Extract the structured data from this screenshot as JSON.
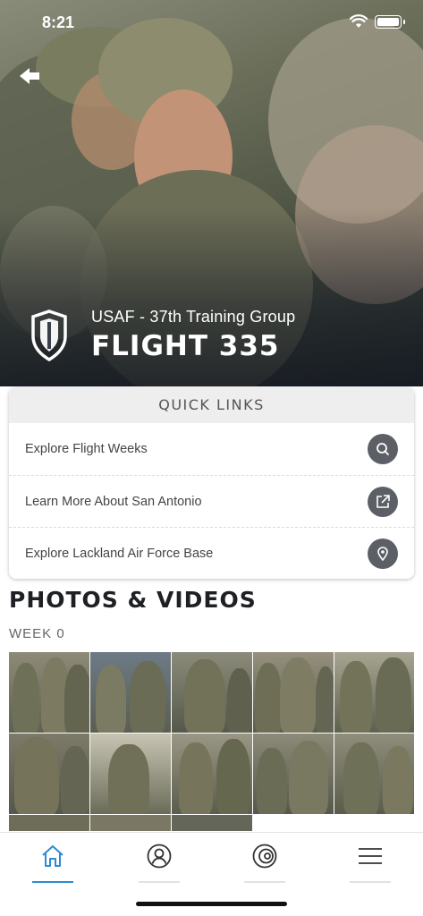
{
  "status_bar": {
    "time": "8:21"
  },
  "hero": {
    "subtitle": "USAF - 37th Training Group",
    "title": "FLIGHT 335"
  },
  "quick_links": {
    "header": "QUICK LINKS",
    "items": [
      {
        "label": "Explore Flight Weeks",
        "icon": "search-icon"
      },
      {
        "label": "Learn More About San Antonio",
        "icon": "external-link-icon"
      },
      {
        "label": "Explore Lackland Air Force Base",
        "icon": "map-pin-icon"
      }
    ]
  },
  "photos": {
    "title": "PHOTOS & VIDEOS",
    "week": "WEEK 0"
  },
  "tabbar": {
    "tabs": [
      {
        "name": "home",
        "icon": "home-icon",
        "active": true
      },
      {
        "name": "profile",
        "icon": "user-icon",
        "active": false
      },
      {
        "name": "target",
        "icon": "target-icon",
        "active": false
      },
      {
        "name": "menu",
        "icon": "menu-icon",
        "active": false
      }
    ]
  },
  "colors": {
    "accent": "#2b8bd3",
    "icon_circle": "#5c6066",
    "header_bg": "#eeeeee"
  }
}
